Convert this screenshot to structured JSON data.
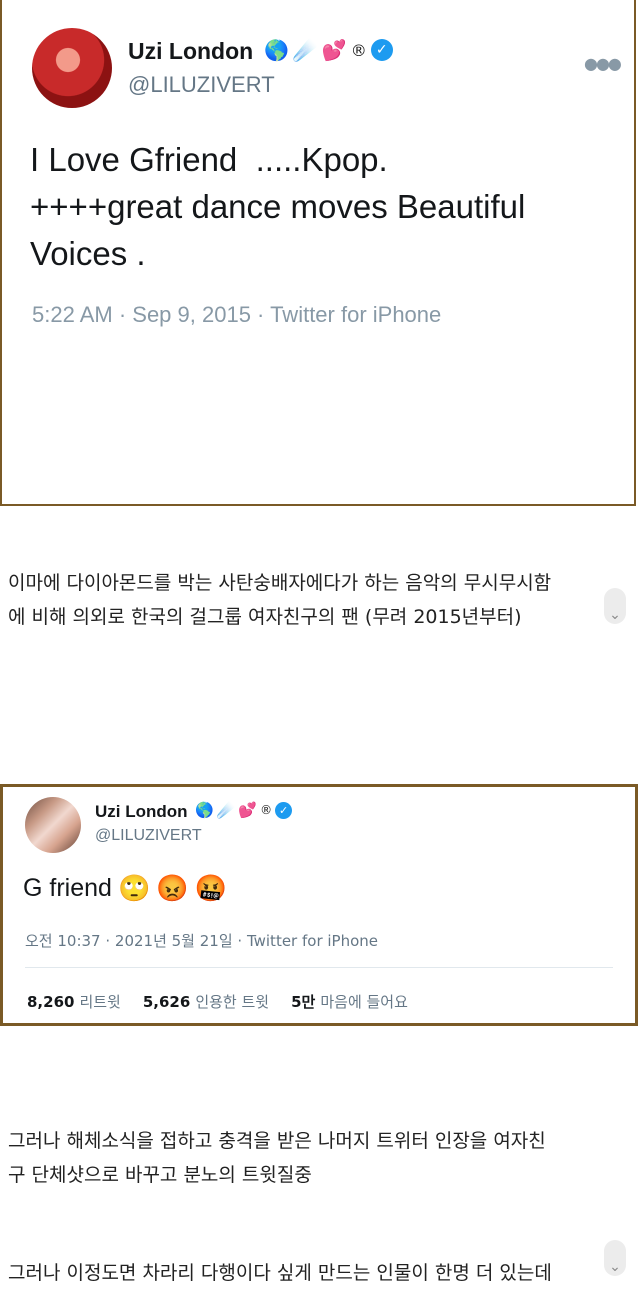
{
  "tweet1": {
    "display_name": "Uzi London",
    "name_emojis": [
      "🌎",
      "☄️",
      "💕",
      "®"
    ],
    "verified_mark": "✓",
    "handle": "@LILUZIVERT",
    "more_icon": "●●●",
    "lines": [
      "I Love Gfriend  .....Kpop.",
      "++++great dance moves Beautiful",
      "Voices ."
    ],
    "meta": "5:22 AM · Sep 9, 2015 · Twitter for iPhone"
  },
  "paragraph1": {
    "line1": "이마에 다이아몬드를 박는 사탄숭배자에다가 하는 음악의 무시무시함",
    "line2": "에 비해 의외로 한국의 걸그룹 여자친구의 팬 (무려 2015년부터)"
  },
  "tweet2": {
    "display_name": "Uzi London",
    "name_emojis": [
      "🌎",
      "☄️",
      "💕",
      "®"
    ],
    "verified_mark": "✓",
    "handle": "@LILUZIVERT",
    "text": "G friend",
    "text_emojis": [
      "🙄",
      "😡",
      "🤬"
    ],
    "meta": "오전 10:37 · 2021년 5월 21일 · Twitter for iPhone",
    "stats": [
      {
        "count": "8,260",
        "label": "리트윗"
      },
      {
        "count": "5,626",
        "label": "인용한 트윗"
      },
      {
        "count": "5만",
        "label": "마음에 들어요"
      }
    ]
  },
  "paragraph2": {
    "line1": "그러나 해체소식을 접하고 충격을 받은 나머지 트위터 인장을 여자친",
    "line2": "구 단체샷으로 바꾸고 분노의 트윗질중"
  },
  "paragraph3": {
    "line1": "그러나 이정도면 차라리 다행이다 싶게 만드는 인물이 한명 더 있는데"
  },
  "scroll_icon": "⌄"
}
